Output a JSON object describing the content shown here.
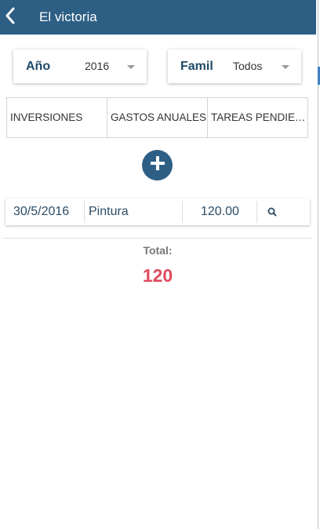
{
  "header": {
    "title": "El victoria",
    "back_icon": "chevron-left-icon"
  },
  "filters": {
    "year": {
      "label": "Año",
      "value": "2016"
    },
    "family": {
      "label": "Famil",
      "value": "Todos"
    }
  },
  "tabs": [
    {
      "label": "INVERSIONES"
    },
    {
      "label": "GASTOS ANUALES"
    },
    {
      "label": "TAREAS PENDIENTES"
    }
  ],
  "add_button": {
    "icon": "plus-icon"
  },
  "entries": [
    {
      "date": "30/5/2016",
      "description": "Pintura",
      "amount": "120.00",
      "action_icon": "search-icon"
    }
  ],
  "summary": {
    "total_label": "Total:",
    "total_value": "120"
  },
  "colors": {
    "header_bg": "#2d5f85",
    "accent": "#3e7fc1",
    "total": "#e04a5f"
  }
}
